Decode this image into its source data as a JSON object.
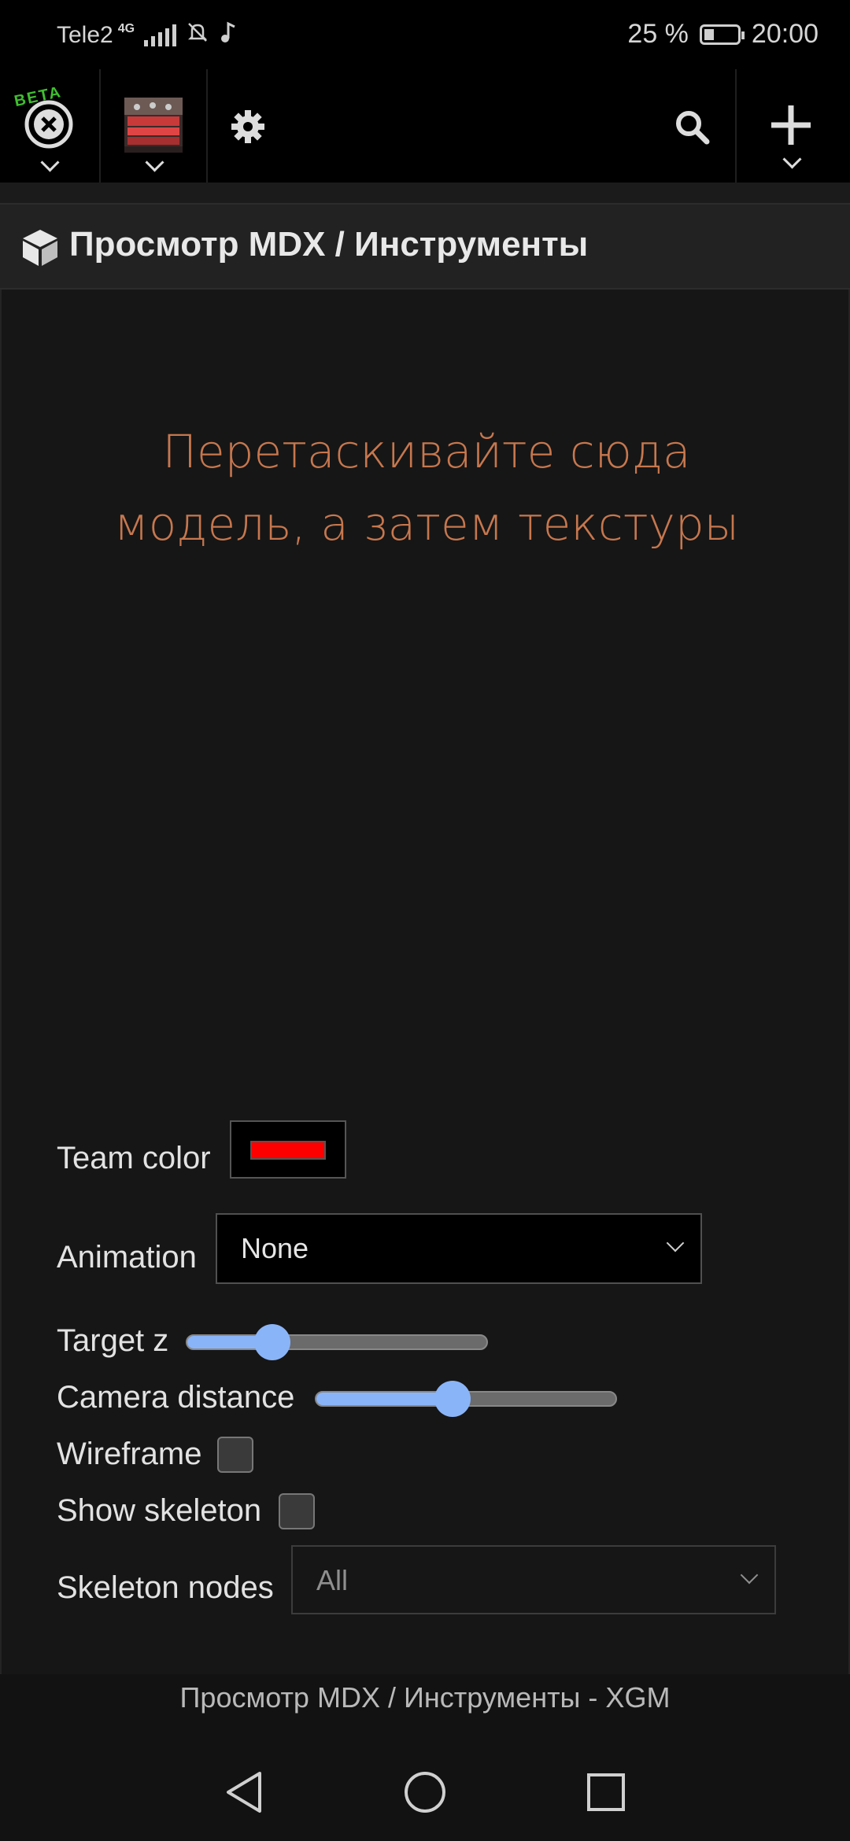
{
  "status_bar": {
    "carrier": "Tele2",
    "network": "4G",
    "battery_percent": "25 %",
    "time": "20:00"
  },
  "toolbar": {
    "beta_badge": "BETA"
  },
  "section": {
    "title": "Просмотр MDX / Инструменты"
  },
  "drop_hint": {
    "line1": "Перетаскивайте сюда",
    "line2": "модель, а затем текстуры"
  },
  "controls": {
    "team_color_label": "Team color",
    "team_color_value": "#ff0000",
    "animation_label": "Animation",
    "animation_selected": "None",
    "target_z_label": "Target z",
    "target_z_value": 0.28,
    "camera_distance_label": "Camera distance",
    "camera_distance_value": 0.45,
    "wireframe_label": "Wireframe",
    "wireframe_checked": false,
    "show_skeleton_label": "Show skeleton",
    "show_skeleton_checked": false,
    "skeleton_nodes_label": "Skeleton nodes",
    "skeleton_nodes_selected": "All"
  },
  "footer": {
    "page_title": "Просмотр MDX / Инструменты - XGM"
  },
  "colors": {
    "accent": "#8ab4f8",
    "hint": "#c7774e",
    "beta": "#3fbf2f"
  }
}
